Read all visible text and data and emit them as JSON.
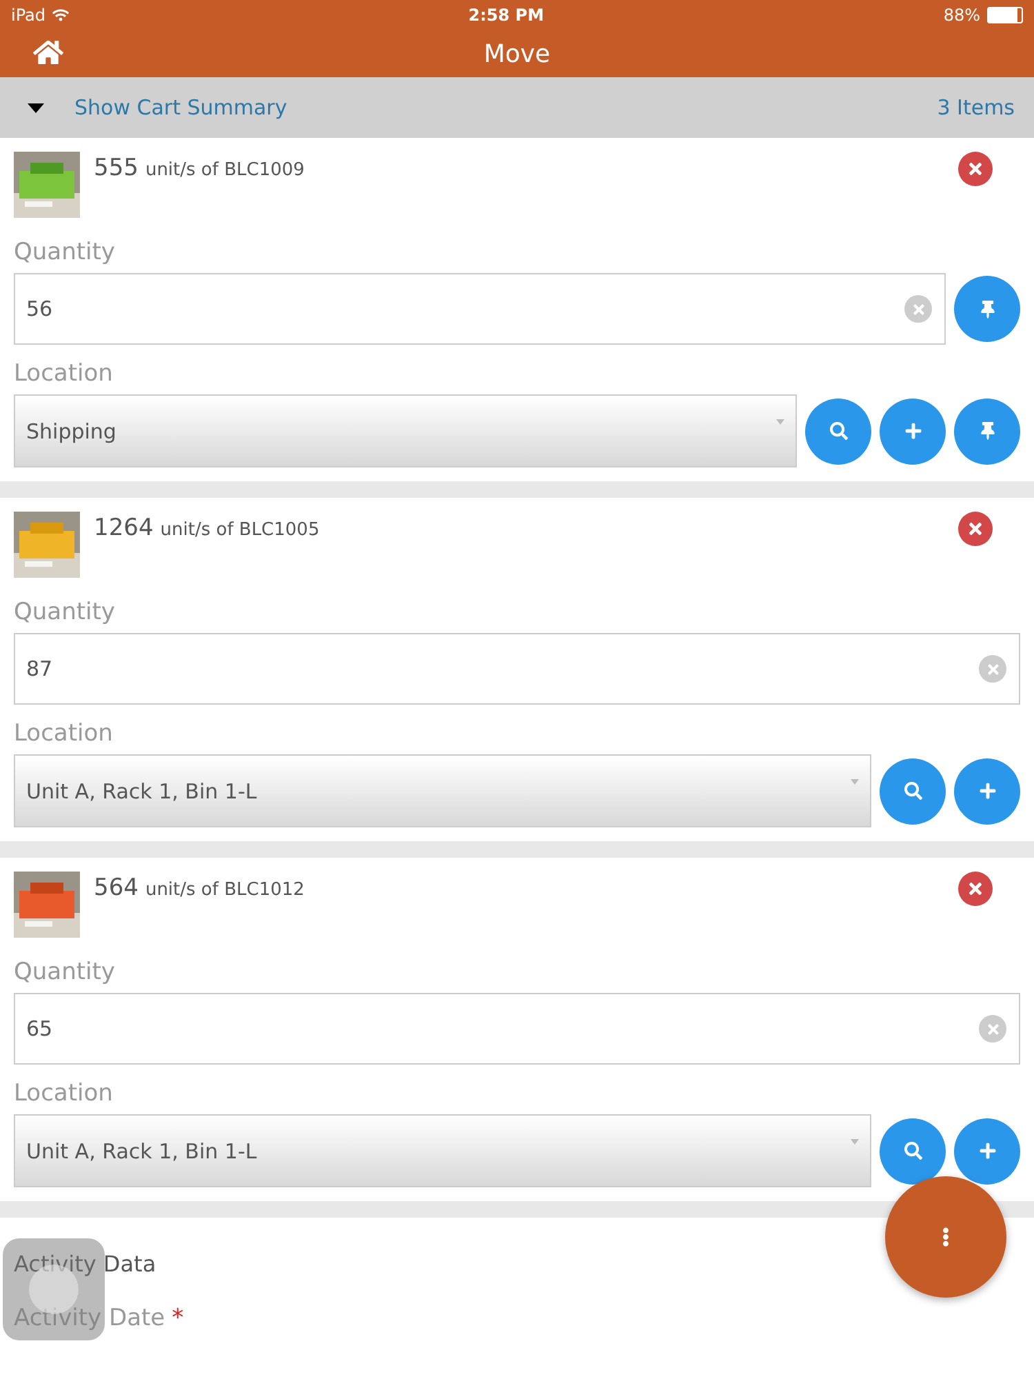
{
  "status_bar": {
    "device": "iPad",
    "time": "2:58 PM",
    "battery": "88%"
  },
  "nav": {
    "title": "Move"
  },
  "cart_summary": {
    "label": "Show Cart Summary",
    "expanded": false,
    "count": "3 Items"
  },
  "items": [
    {
      "quantity": "555",
      "unit_text": "unit/s of BLC1009",
      "quantity_label": "Quantity",
      "quantity_value": "56",
      "quantity_pin": true,
      "location_label": "Location",
      "location_value": "Shipping",
      "location_buttons": [
        {
          "kind": "search"
        },
        {
          "kind": "add"
        },
        {
          "kind": "pin"
        }
      ]
    },
    {
      "quantity": "1264",
      "unit_text": "unit/s of BLC1005",
      "quantity_label": "Quantity",
      "quantity_value": "87",
      "quantity_pin": false,
      "location_label": "Location",
      "location_value": "Unit A, Rack 1, Bin 1-L",
      "location_buttons": [
        {
          "kind": "search"
        },
        {
          "kind": "add"
        }
      ]
    },
    {
      "quantity": "564",
      "unit_text": "unit/s of BLC1012",
      "quantity_label": "Quantity",
      "quantity_value": "65",
      "quantity_pin": false,
      "location_label": "Location",
      "location_value": "Unit A, Rack 1, Bin 1-L",
      "location_buttons": [
        {
          "kind": "search"
        },
        {
          "kind": "add"
        }
      ]
    }
  ],
  "activity": {
    "heading": "Activity Data",
    "date_label": "Activity Date",
    "required_mark": "*"
  }
}
